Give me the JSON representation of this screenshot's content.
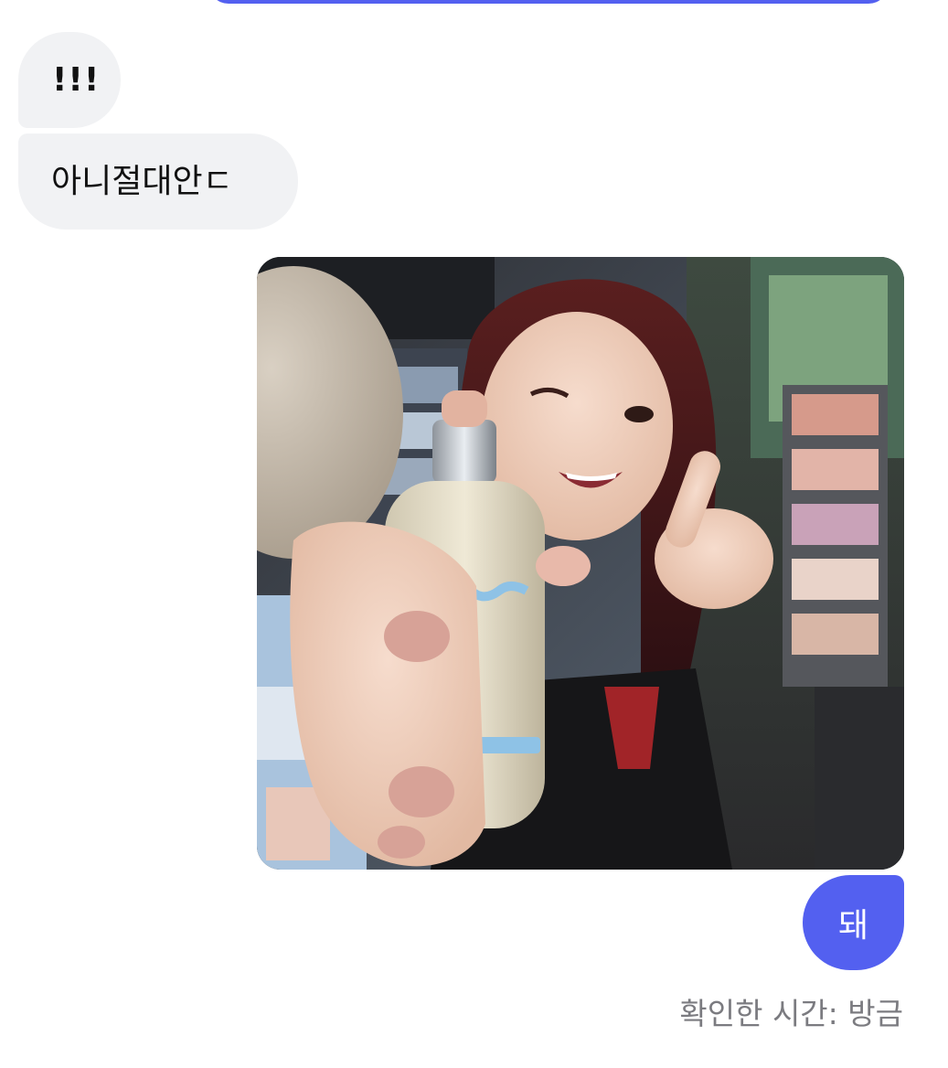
{
  "messages": [
    {
      "direction": "incoming",
      "text": "!!!"
    },
    {
      "direction": "incoming",
      "text": "아니절대안ㄷ"
    },
    {
      "direction": "outgoing",
      "type": "photo",
      "icon": "photo"
    },
    {
      "direction": "outgoing",
      "text": "돼"
    }
  ],
  "read_receipt": "확인한 시간: 방금",
  "colors": {
    "outgoing_bubble": "#5360f0",
    "incoming_bubble": "#f1f2f4",
    "receipt_text": "#7b7b80"
  }
}
